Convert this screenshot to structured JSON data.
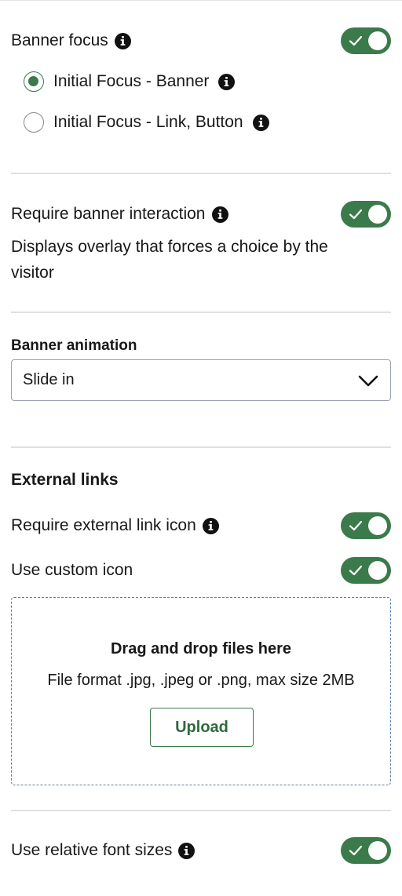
{
  "banner_focus": {
    "label": "Banner focus",
    "info_icon": "info-icon",
    "toggle_on": true,
    "options": [
      {
        "label": "Initial Focus - Banner",
        "checked": true
      },
      {
        "label": "Initial Focus - Link, Button",
        "checked": false
      }
    ]
  },
  "banner_interaction": {
    "label": "Require banner interaction",
    "toggle_on": true,
    "description": "Displays overlay that forces a choice by the visitor"
  },
  "banner_animation": {
    "title": "Banner animation",
    "selected": "Slide in",
    "dropdown_icon": "chevron-down-icon"
  },
  "external_links": {
    "title": "External links",
    "require_icon_label": "Require external link icon",
    "require_icon_on": true,
    "custom_icon_label": "Use custom icon",
    "custom_icon_on": true,
    "dropzone_title": "Drag and drop files here",
    "dropzone_subtitle": "File format .jpg, .jpeg or .png, max size 2MB",
    "upload_label": "Upload"
  },
  "relative_fonts": {
    "label": "Use relative font sizes",
    "toggle_on": true
  },
  "colors": {
    "accent": "#3b7a4b",
    "divider": "#e0e0e0",
    "text": "#181818"
  }
}
